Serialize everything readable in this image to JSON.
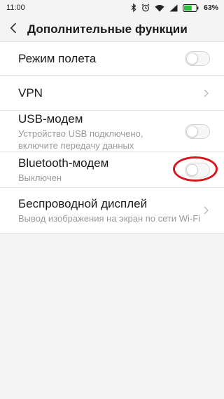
{
  "status_bar": {
    "time": "11:00",
    "battery_percent": "63%",
    "icons": [
      "bluetooth-icon",
      "alarm-icon",
      "wifi-icon",
      "signal-icon",
      "battery-icon"
    ]
  },
  "header": {
    "title": "Дополнительные функции",
    "back_icon": "chevron-left-icon"
  },
  "settings": [
    {
      "title": "Режим полета",
      "subtitle": "",
      "control": "toggle",
      "enabled": false
    },
    {
      "title": "VPN",
      "subtitle": "",
      "control": "chevron"
    },
    {
      "title": "USB-модем",
      "subtitle": "Устройство USB подключено, включите передачу данных",
      "control": "toggle",
      "enabled": false
    },
    {
      "title": "Bluetooth-модем",
      "subtitle": "Выключен",
      "control": "toggle",
      "enabled": false,
      "highlighted": true
    },
    {
      "title": "Беспроводной дисплей",
      "subtitle": "Вывод изображения на экран по сети Wi-Fi",
      "control": "chevron"
    }
  ],
  "colors": {
    "background": "#f4f4f4",
    "list_background": "#ffffff",
    "highlight": "#d8161d",
    "battery_fill": "#2dbf3e"
  }
}
